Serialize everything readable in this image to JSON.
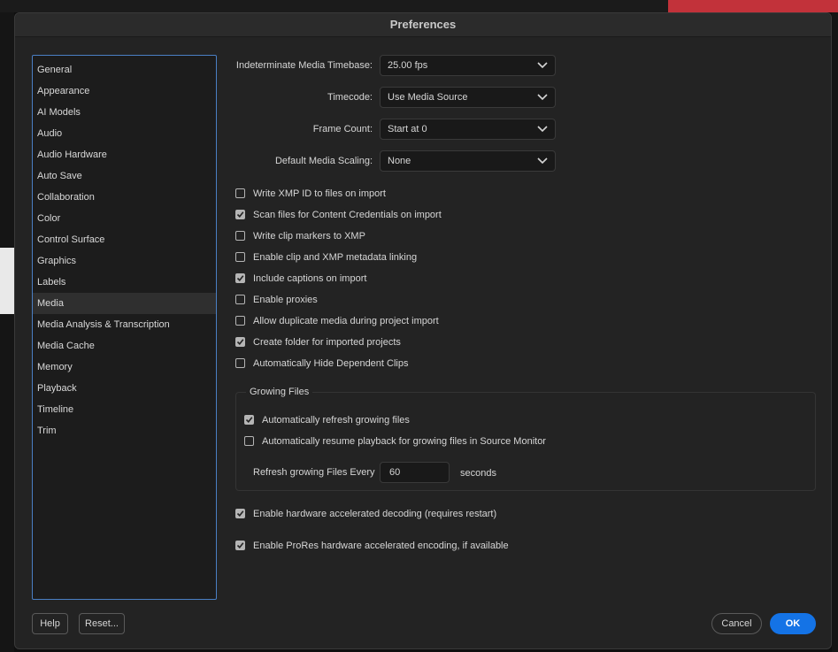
{
  "dialog": {
    "title": "Preferences"
  },
  "sidebar": {
    "items": [
      {
        "label": "General"
      },
      {
        "label": "Appearance"
      },
      {
        "label": "AI Models"
      },
      {
        "label": "Audio"
      },
      {
        "label": "Audio Hardware"
      },
      {
        "label": "Auto Save"
      },
      {
        "label": "Collaboration"
      },
      {
        "label": "Color"
      },
      {
        "label": "Control Surface"
      },
      {
        "label": "Graphics"
      },
      {
        "label": "Labels"
      },
      {
        "label": "Media"
      },
      {
        "label": "Media Analysis & Transcription"
      },
      {
        "label": "Media Cache"
      },
      {
        "label": "Memory"
      },
      {
        "label": "Playback"
      },
      {
        "label": "Timeline"
      },
      {
        "label": "Trim"
      }
    ],
    "active": "Media"
  },
  "settings": {
    "timebase": {
      "label": "Indeterminate Media Timebase:",
      "value": "25.00 fps"
    },
    "timecode": {
      "label": "Timecode:",
      "value": "Use Media Source"
    },
    "frame_count": {
      "label": "Frame Count:",
      "value": "Start at 0"
    },
    "scaling": {
      "label": "Default Media Scaling:",
      "value": "None"
    }
  },
  "checkboxes": [
    {
      "label": "Write XMP ID to files on import",
      "checked": false
    },
    {
      "label": "Scan files for Content Credentials on import",
      "checked": true
    },
    {
      "label": "Write clip markers to XMP",
      "checked": false
    },
    {
      "label": "Enable clip and XMP metadata linking",
      "checked": false
    },
    {
      "label": "Include captions on import",
      "checked": true
    },
    {
      "label": "Enable proxies",
      "checked": false
    },
    {
      "label": "Allow duplicate media during project import",
      "checked": false
    },
    {
      "label": "Create folder for imported projects",
      "checked": true
    },
    {
      "label": "Automatically Hide Dependent Clips",
      "checked": false
    }
  ],
  "growing_files": {
    "title": "Growing Files",
    "auto_refresh": {
      "label": "Automatically refresh growing files",
      "checked": true
    },
    "auto_resume": {
      "label": "Automatically resume playback for growing files in Source Monitor",
      "checked": false
    },
    "refresh_label": "Refresh growing Files Every",
    "refresh_value": "60",
    "refresh_unit": "seconds"
  },
  "hardware": [
    {
      "label": "Enable hardware accelerated decoding (requires restart)",
      "checked": true
    },
    {
      "label": "Enable ProRes hardware accelerated encoding, if available",
      "checked": true
    }
  ],
  "buttons": {
    "help": "Help",
    "reset": "Reset...",
    "cancel": "Cancel",
    "ok": "OK"
  },
  "colors": {
    "accent": "#1473e6",
    "sidebar_border": "#4a7fc4"
  }
}
